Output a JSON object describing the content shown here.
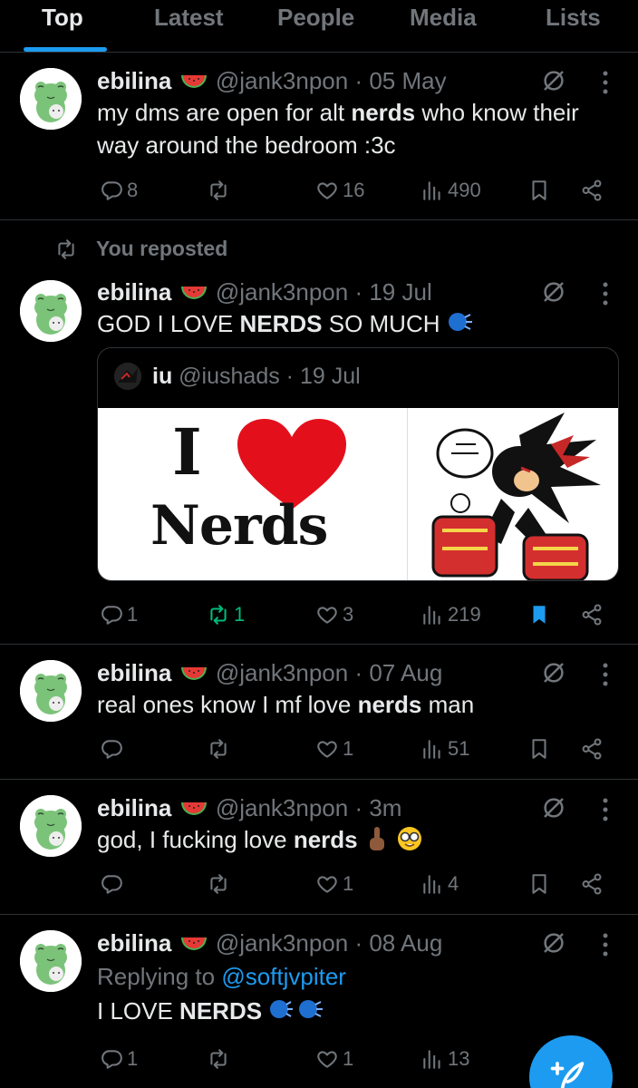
{
  "tabs": [
    "Top",
    "Latest",
    "People",
    "Media",
    "Lists"
  ],
  "repost_label": "You reposted",
  "posts": [
    {
      "name": "ebilina",
      "handle": "@jank3npon",
      "date": "05 May",
      "text_before": "my dms are open for alt ",
      "text_bold": "nerds",
      "text_after": " who know their way around the bedroom :3c",
      "replies": "8",
      "reposts": "",
      "likes": "16",
      "views": "490"
    },
    {
      "name": "ebilina",
      "handle": "@jank3npon",
      "date": "19 Jul",
      "text_before": "GOD I LOVE ",
      "text_bold": "NERDS",
      "text_after": " SO MUCH",
      "replies": "1",
      "reposts": "1",
      "likes": "3",
      "views": "219",
      "quote": {
        "name": "iu",
        "handle": "@iushads",
        "date": "19 Jul",
        "image_text_i": "I",
        "image_text_nerds": "Nerds"
      }
    },
    {
      "name": "ebilina",
      "handle": "@jank3npon",
      "date": "07 Aug",
      "text_before": "real ones know I mf love ",
      "text_bold": "nerds",
      "text_after": " man",
      "replies": "",
      "reposts": "",
      "likes": "1",
      "views": "51"
    },
    {
      "name": "ebilina",
      "handle": "@jank3npon",
      "date": "3m",
      "text_before": "god, I fucking love ",
      "text_bold": "nerds",
      "text_after": "",
      "replies": "",
      "reposts": "",
      "likes": "1",
      "views": "4"
    },
    {
      "name": "ebilina",
      "handle": "@jank3npon",
      "date": "08 Aug",
      "replying_prefix": "Replying to ",
      "replying_to": "@softjvpiter",
      "text_before": "I LOVE ",
      "text_bold": "NERDS",
      "text_after": "",
      "replies": "1",
      "reposts": "",
      "likes": "1",
      "views": "13"
    }
  ],
  "colors": {
    "accent": "#1d9bf0",
    "repost_active": "#00ba7c",
    "muted": "#71767b",
    "text": "#e7e9ea",
    "background": "#000000"
  }
}
